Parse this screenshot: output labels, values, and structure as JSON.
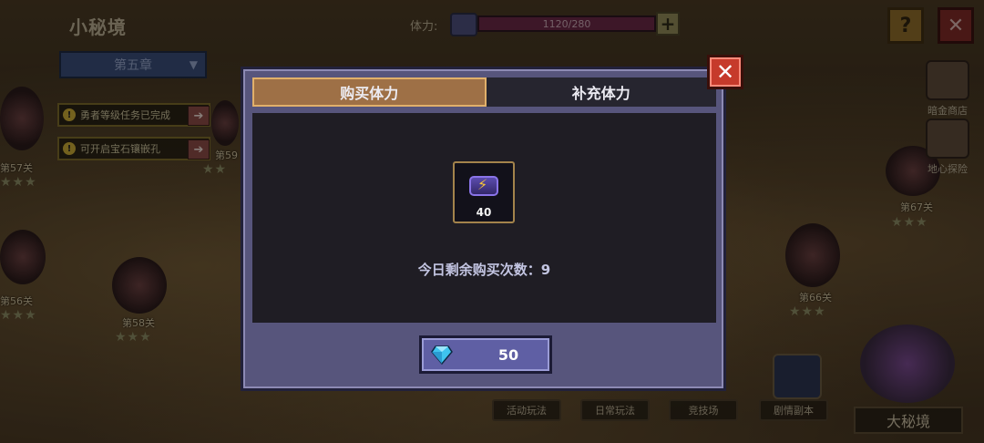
{
  "header": {
    "title": "小秘境",
    "chapter": "第五章",
    "stamina_label": "体力:",
    "stamina_value": "1120/280",
    "plus": "+",
    "help": "?",
    "close": "✕"
  },
  "quests": [
    {
      "text": "勇者等级任务已完成"
    },
    {
      "text": "可开启宝石镶嵌孔"
    }
  ],
  "levels": [
    {
      "label": "第57关"
    },
    {
      "label": "第59"
    },
    {
      "label": "第56关"
    },
    {
      "label": "第58关"
    },
    {
      "label": "第67关"
    },
    {
      "label": "第66关"
    }
  ],
  "side_buttons": [
    {
      "label": "暗金商店"
    },
    {
      "label": "地心探险"
    }
  ],
  "bottom_tabs": [
    "活动玩法",
    "日常玩法",
    "竞技场",
    "剧情副本"
  ],
  "big_realm": "大秘境",
  "modal": {
    "tabs": [
      {
        "label": "购买体力",
        "active": true
      },
      {
        "label": "补充体力",
        "active": false
      }
    ],
    "item_quantity": "40",
    "remaining_text": "今日剩余购买次数：9",
    "price": "50",
    "close": "✕"
  },
  "colors": {
    "modal_bg": "#57557c",
    "active_tab": "#9e7046",
    "buy_button": "#5f5fa4",
    "close_button": "#c63a2b"
  },
  "icons": {
    "stamina": "battery-icon",
    "price": "diamond-icon",
    "item": "battery-icon"
  }
}
